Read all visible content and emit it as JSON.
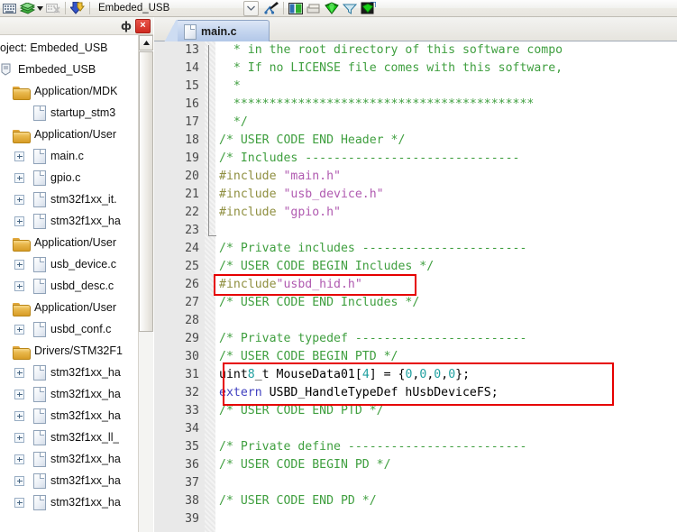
{
  "toolbar": {
    "project_name": "Embeded_USB",
    "icons": [
      {
        "name": "keyboard-icon",
        "glyph": "keyboard"
      },
      {
        "name": "books-icon",
        "glyph": "books"
      },
      {
        "name": "dropdown-caret-icon",
        "glyph": "caret-down"
      },
      {
        "name": "keyboard-disabled-icon",
        "glyph": "keyboard-x"
      },
      {
        "name": "download-to-target-icon",
        "glyph": "download-arrow"
      },
      {
        "name": "combo-expand-icon",
        "glyph": "chevron-down"
      },
      {
        "name": "manage-project-items-icon",
        "glyph": "project-items"
      },
      {
        "name": "configuration-wizard-icon",
        "glyph": "config-panel"
      },
      {
        "name": "batch-build-icon",
        "glyph": "stack"
      },
      {
        "name": "green-diamond-icon",
        "glyph": "diamond-green"
      },
      {
        "name": "filter-funnel-icon",
        "glyph": "funnel"
      },
      {
        "name": "pack-installer-icon",
        "glyph": "pack-green"
      }
    ]
  },
  "left_panel": {
    "pin_label": "ф",
    "close_label": "×",
    "title_line": "oject: Embeded_USB",
    "tree": [
      {
        "indent": 0,
        "type": "project",
        "label": "oject: Embeded_USB",
        "expander": false
      },
      {
        "indent": 0,
        "type": "target",
        "label": "Embeded_USB",
        "expander": false
      },
      {
        "indent": 1,
        "type": "folder",
        "label": "Application/MDK",
        "expander": false
      },
      {
        "indent": 2,
        "type": "file",
        "label": "startup_stm3",
        "expander": false
      },
      {
        "indent": 1,
        "type": "folder",
        "label": "Application/User",
        "expander": false
      },
      {
        "indent": 2,
        "type": "file",
        "label": "main.c",
        "expander": true
      },
      {
        "indent": 2,
        "type": "file",
        "label": "gpio.c",
        "expander": true
      },
      {
        "indent": 2,
        "type": "file",
        "label": "stm32f1xx_it.",
        "expander": true
      },
      {
        "indent": 2,
        "type": "file",
        "label": "stm32f1xx_ha",
        "expander": true
      },
      {
        "indent": 1,
        "type": "folder",
        "label": "Application/User",
        "expander": false
      },
      {
        "indent": 2,
        "type": "file",
        "label": "usb_device.c",
        "expander": true
      },
      {
        "indent": 2,
        "type": "file",
        "label": "usbd_desc.c",
        "expander": true
      },
      {
        "indent": 1,
        "type": "folder",
        "label": "Application/User",
        "expander": false
      },
      {
        "indent": 2,
        "type": "file",
        "label": "usbd_conf.c",
        "expander": true
      },
      {
        "indent": 1,
        "type": "folder",
        "label": "Drivers/STM32F1",
        "expander": false
      },
      {
        "indent": 2,
        "type": "file",
        "label": "stm32f1xx_ha",
        "expander": true
      },
      {
        "indent": 2,
        "type": "file",
        "label": "stm32f1xx_ha",
        "expander": true
      },
      {
        "indent": 2,
        "type": "file",
        "label": "stm32f1xx_ha",
        "expander": true
      },
      {
        "indent": 2,
        "type": "file",
        "label": "stm32f1xx_ll_",
        "expander": true
      },
      {
        "indent": 2,
        "type": "file",
        "label": "stm32f1xx_ha",
        "expander": true
      },
      {
        "indent": 2,
        "type": "file",
        "label": "stm32f1xx_ha",
        "expander": true
      },
      {
        "indent": 2,
        "type": "file",
        "label": "stm32f1xx_ha",
        "expander": true
      }
    ]
  },
  "editor": {
    "tab_label": "main.c",
    "first_line_number": 13,
    "lines": [
      {
        "n": 13,
        "tokens": [
          {
            "t": "  * in the root directory of this software compo",
            "c": "c-com"
          }
        ]
      },
      {
        "n": 14,
        "tokens": [
          {
            "t": "  * If no LICENSE file comes with this software,",
            "c": "c-com"
          }
        ]
      },
      {
        "n": 15,
        "tokens": [
          {
            "t": "  *",
            "c": "c-com"
          }
        ]
      },
      {
        "n": 16,
        "tokens": [
          {
            "t": "  ******************************************",
            "c": "c-com"
          }
        ]
      },
      {
        "n": 17,
        "tokens": [
          {
            "t": "  */",
            "c": "c-com"
          }
        ]
      },
      {
        "n": 18,
        "tokens": [
          {
            "t": "/* USER CODE END Header */",
            "c": "c-com"
          }
        ]
      },
      {
        "n": 19,
        "tokens": [
          {
            "t": "/* Includes ------------------------------",
            "c": "c-com"
          }
        ]
      },
      {
        "n": 20,
        "tokens": [
          {
            "t": "#include ",
            "c": "c-pre"
          },
          {
            "t": "\"main.h\"",
            "c": "c-str"
          }
        ]
      },
      {
        "n": 21,
        "tokens": [
          {
            "t": "#include ",
            "c": "c-pre"
          },
          {
            "t": "\"usb_device.h\"",
            "c": "c-str"
          }
        ]
      },
      {
        "n": 22,
        "tokens": [
          {
            "t": "#include ",
            "c": "c-pre"
          },
          {
            "t": "\"gpio.h\"",
            "c": "c-str"
          }
        ]
      },
      {
        "n": 23,
        "tokens": [
          {
            "t": "",
            "c": "c-pln"
          }
        ]
      },
      {
        "n": 24,
        "tokens": [
          {
            "t": "/* Private includes -----------------------",
            "c": "c-com"
          }
        ]
      },
      {
        "n": 25,
        "tokens": [
          {
            "t": "/* USER CODE BEGIN Includes */",
            "c": "c-com"
          }
        ]
      },
      {
        "n": 26,
        "tokens": [
          {
            "t": "#include",
            "c": "c-pre"
          },
          {
            "t": "\"usbd_hid.h\"",
            "c": "c-str"
          }
        ]
      },
      {
        "n": 27,
        "tokens": [
          {
            "t": "/* USER CODE END Includes */",
            "c": "c-com"
          }
        ]
      },
      {
        "n": 28,
        "tokens": [
          {
            "t": "",
            "c": "c-pln"
          }
        ]
      },
      {
        "n": 29,
        "tokens": [
          {
            "t": "/* Private typedef ------------------------",
            "c": "c-com"
          }
        ]
      },
      {
        "n": 30,
        "tokens": [
          {
            "t": "/* USER CODE BEGIN PTD */",
            "c": "c-com"
          }
        ]
      },
      {
        "n": 31,
        "tokens": [
          {
            "t": "uint",
            "c": "c-pln"
          },
          {
            "t": "8",
            "c": "c-num"
          },
          {
            "t": "_t MouseData01[",
            "c": "c-pln"
          },
          {
            "t": "4",
            "c": "c-num"
          },
          {
            "t": "] = {",
            "c": "c-pln"
          },
          {
            "t": "0",
            "c": "c-num"
          },
          {
            "t": ",",
            "c": "c-pln"
          },
          {
            "t": "0",
            "c": "c-num"
          },
          {
            "t": ",",
            "c": "c-pln"
          },
          {
            "t": "0",
            "c": "c-num"
          },
          {
            "t": ",",
            "c": "c-pln"
          },
          {
            "t": "0",
            "c": "c-num"
          },
          {
            "t": "};",
            "c": "c-pln"
          }
        ]
      },
      {
        "n": 32,
        "tokens": [
          {
            "t": "extern",
            "c": "c-kw"
          },
          {
            "t": " USBD_HandleTypeDef hUsbDeviceFS;",
            "c": "c-pln"
          }
        ]
      },
      {
        "n": 33,
        "tokens": [
          {
            "t": "/* USER CODE END PTD */",
            "c": "c-com"
          }
        ]
      },
      {
        "n": 34,
        "tokens": [
          {
            "t": "",
            "c": "c-pln"
          }
        ]
      },
      {
        "n": 35,
        "tokens": [
          {
            "t": "/* Private define -------------------------",
            "c": "c-com"
          }
        ]
      },
      {
        "n": 36,
        "tokens": [
          {
            "t": "/* USER CODE BEGIN PD */",
            "c": "c-com"
          }
        ]
      },
      {
        "n": 37,
        "tokens": [
          {
            "t": "",
            "c": "c-pln"
          }
        ]
      },
      {
        "n": 38,
        "tokens": [
          {
            "t": "/* USER CODE END PD */",
            "c": "c-com"
          }
        ]
      },
      {
        "n": 39,
        "tokens": [
          {
            "t": "",
            "c": "c-pln"
          }
        ]
      }
    ],
    "annotations": [
      {
        "name": "highlight-box-include-usbd-hid",
        "line_start": 26,
        "line_end": 26
      },
      {
        "name": "highlight-box-mousedata-extern",
        "line_start": 31,
        "line_end": 32
      }
    ]
  },
  "colors": {
    "annotation_red": "#e60000",
    "comment_green": "#3f9f3f",
    "string_purple": "#b05ab0",
    "preproc_olive": "#8f8f40",
    "keyword_blue": "#4040c0",
    "number_teal": "#20a0a0"
  }
}
